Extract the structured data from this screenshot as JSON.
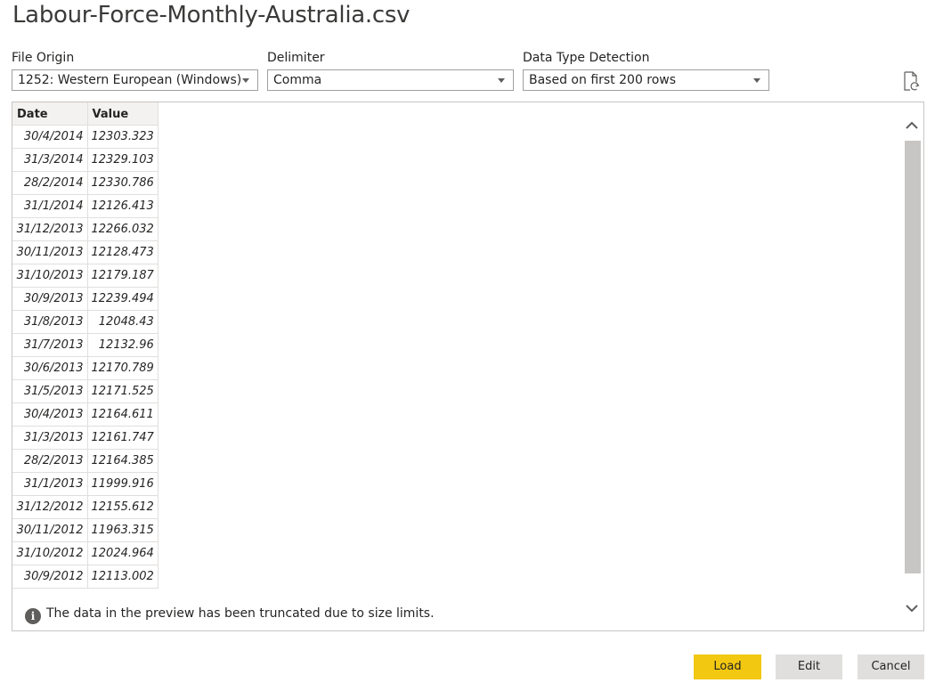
{
  "dialog": {
    "title": "Labour-Force-Monthly-Australia.csv"
  },
  "file_origin": {
    "label": "File Origin",
    "value": "1252: Western European (Windows)"
  },
  "delimiter": {
    "label": "Delimiter",
    "value": "Comma"
  },
  "data_type_detection": {
    "label": "Data Type Detection",
    "value": "Based on first 200 rows"
  },
  "preview": {
    "columns": [
      "Date",
      "Value"
    ],
    "rows": [
      [
        "30/4/2014",
        "12303.323"
      ],
      [
        "31/3/2014",
        "12329.103"
      ],
      [
        "28/2/2014",
        "12330.786"
      ],
      [
        "31/1/2014",
        "12126.413"
      ],
      [
        "31/12/2013",
        "12266.032"
      ],
      [
        "30/11/2013",
        "12128.473"
      ],
      [
        "31/10/2013",
        "12179.187"
      ],
      [
        "30/9/2013",
        "12239.494"
      ],
      [
        "31/8/2013",
        "12048.43"
      ],
      [
        "31/7/2013",
        "12132.96"
      ],
      [
        "30/6/2013",
        "12170.789"
      ],
      [
        "31/5/2013",
        "12171.525"
      ],
      [
        "30/4/2013",
        "12164.611"
      ],
      [
        "31/3/2013",
        "12161.747"
      ],
      [
        "28/2/2013",
        "12164.385"
      ],
      [
        "31/1/2013",
        "11999.916"
      ],
      [
        "31/12/2012",
        "12155.612"
      ],
      [
        "30/11/2012",
        "11963.315"
      ],
      [
        "31/10/2012",
        "12024.964"
      ],
      [
        "30/9/2012",
        "12113.002"
      ]
    ],
    "notice": "The data in the preview has been truncated due to size limits."
  },
  "buttons": {
    "load": "Load",
    "edit": "Edit",
    "cancel": "Cancel"
  },
  "colors": {
    "load_button": "#f2c811",
    "button": "#e1dfdd",
    "border": "#c8c6c4"
  },
  "icons": [
    "refresh-icon",
    "chevron-down-icon",
    "chevron-up-icon",
    "info-icon"
  ]
}
